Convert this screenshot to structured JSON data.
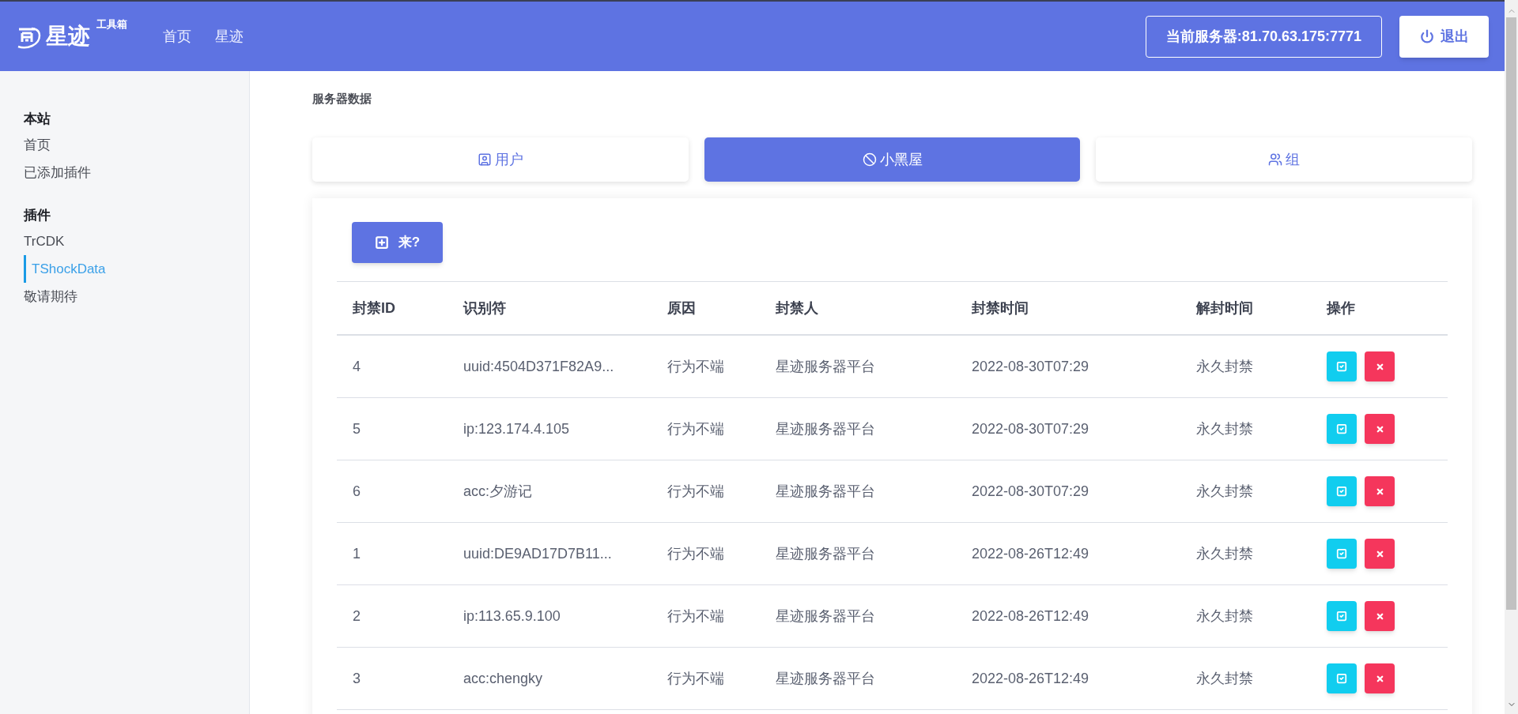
{
  "header": {
    "logo": {
      "name": "星迹",
      "suffix": "工具箱"
    },
    "nav": [
      {
        "label": "首页"
      },
      {
        "label": "星迹"
      }
    ],
    "server": "当前服务器:81.70.63.175:7771",
    "logout": "退出"
  },
  "sidebar": {
    "sections": [
      {
        "title": "本站",
        "items": [
          {
            "label": "首页",
            "selected": false
          },
          {
            "label": "已添加插件",
            "selected": false
          }
        ]
      },
      {
        "title": "插件",
        "items": [
          {
            "label": "TrCDK",
            "selected": false
          },
          {
            "label": "TShockData",
            "selected": true
          },
          {
            "label": "敬请期待",
            "selected": false
          }
        ]
      }
    ]
  },
  "breadcrumb": "服务器数据",
  "tabs": [
    {
      "kind": "user",
      "label": "用户",
      "selected": false
    },
    {
      "kind": "ban",
      "label": "小黑屋",
      "selected": true
    },
    {
      "kind": "group",
      "label": "组",
      "selected": false
    }
  ],
  "add_button": "来?",
  "table": {
    "columns": [
      "封禁ID",
      "识别符",
      "原因",
      "封禁人",
      "封禁时间",
      "解封时间",
      "操作"
    ],
    "rows": [
      [
        "4",
        "uuid:4504D371F82A9...",
        "行为不端",
        "星迹服务器平台",
        "2022-08-30T07:29",
        "永久封禁"
      ],
      [
        "5",
        "ip:123.174.4.105",
        "行为不端",
        "星迹服务器平台",
        "2022-08-30T07:29",
        "永久封禁"
      ],
      [
        "6",
        "acc:夕游记",
        "行为不端",
        "星迹服务器平台",
        "2022-08-30T07:29",
        "永久封禁"
      ],
      [
        "1",
        "uuid:DE9AD17D7B11...",
        "行为不端",
        "星迹服务器平台",
        "2022-08-26T12:49",
        "永久封禁"
      ],
      [
        "2",
        "ip:113.65.9.100",
        "行为不端",
        "星迹服务器平台",
        "2022-08-26T12:49",
        "永久封禁"
      ],
      [
        "3",
        "acc:chengky",
        "行为不端",
        "星迹服务器平台",
        "2022-08-26T12:49",
        "永久封禁"
      ]
    ]
  }
}
